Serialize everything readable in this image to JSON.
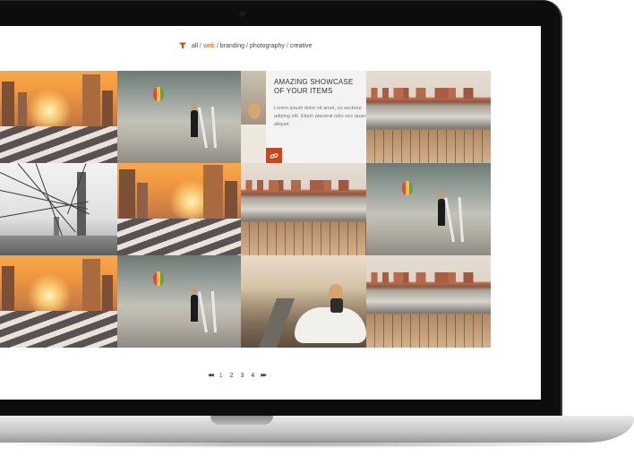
{
  "filter": {
    "icon": "funnel-icon",
    "accent": "#d35400",
    "items": [
      {
        "label": "all",
        "active": false
      },
      {
        "label": "web",
        "active": true
      },
      {
        "label": "branding",
        "active": false
      },
      {
        "label": "photography",
        "active": false
      },
      {
        "label": "creative",
        "active": false
      }
    ],
    "separator": "/"
  },
  "showcase": {
    "heading_line1": "AMAZING SHOWCASE",
    "heading_line2": "OF YOUR ITEMS",
    "body": "Lorem ipsum dolor sit amet, co sectetur adiping elit. Etiam placerat odio nec quam aliquet.",
    "button_icon": "link-icon",
    "button_color": "#d0441c"
  },
  "pagination": {
    "first_icon": "double-chevron-left-icon",
    "last_icon": "double-chevron-right-icon",
    "first_label": "◀◀",
    "last_label": "▶▶",
    "pages": [
      "1",
      "2",
      "3",
      "4"
    ],
    "active_page": "1"
  }
}
